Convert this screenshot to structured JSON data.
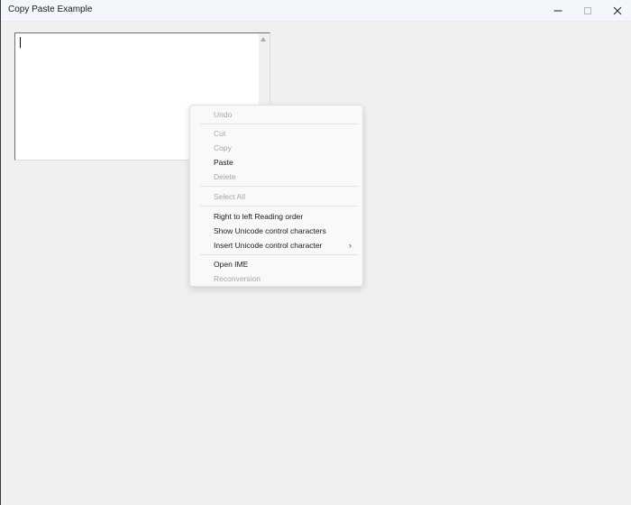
{
  "window": {
    "title": "Copy Paste Example"
  },
  "titlebar": {
    "controls": [
      {
        "name": "minimize",
        "icon": "minimize-icon"
      },
      {
        "name": "maximize",
        "icon": "maximize-icon"
      },
      {
        "name": "close",
        "icon": "close-icon"
      }
    ]
  },
  "textbox": {
    "value": ""
  },
  "context_menu": {
    "items": [
      {
        "label": "Undo",
        "enabled": false
      },
      {
        "label": "Cut",
        "enabled": false
      },
      {
        "label": "Copy",
        "enabled": false
      },
      {
        "label": "Paste",
        "enabled": true
      },
      {
        "label": "Delete",
        "enabled": false
      },
      {
        "label": "Select All",
        "enabled": false
      },
      {
        "label": "Right to left Reading order",
        "enabled": true
      },
      {
        "label": "Show Unicode control characters",
        "enabled": true
      },
      {
        "label": "Insert Unicode control character",
        "enabled": true,
        "submenu": true
      },
      {
        "label": "Open IME",
        "enabled": true
      },
      {
        "label": "Reconversion",
        "enabled": false
      }
    ],
    "submenu_icon": "chevron-right-icon"
  },
  "colors": {
    "window_bg": "#f0f0f0",
    "titlebar_bg": "#f3f6fb",
    "menu_bg": "#f9f9f9",
    "disabled_text": "#a6a6a6",
    "enabled_text": "#1a1a1a"
  }
}
